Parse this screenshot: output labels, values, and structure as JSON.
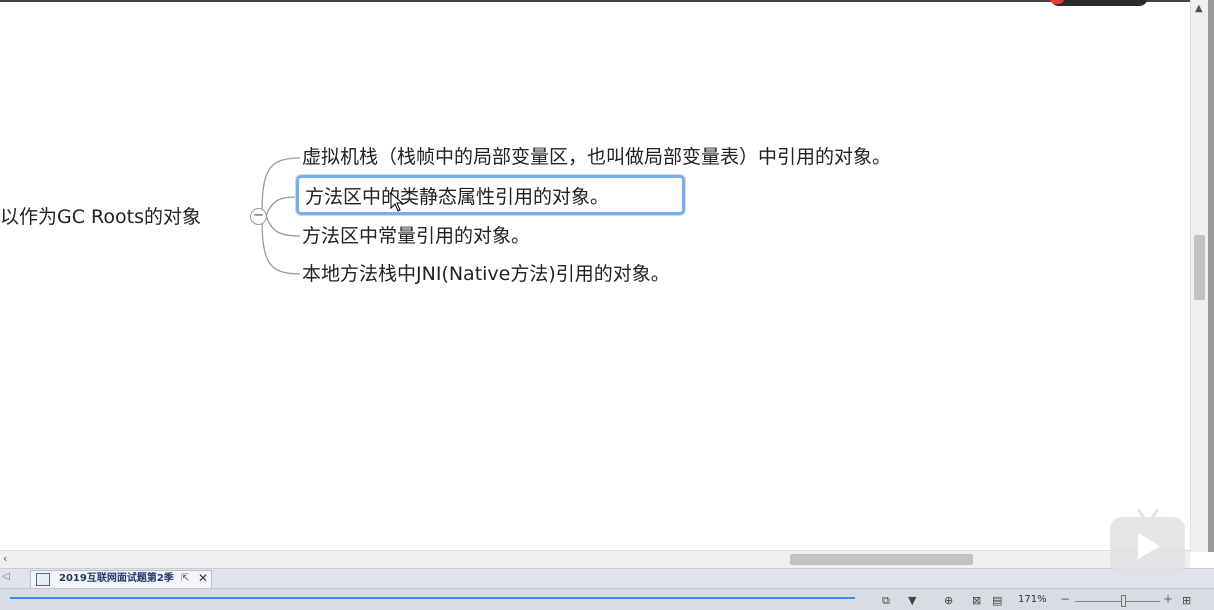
{
  "mindmap": {
    "root_topic": "以作为GC Roots的对象",
    "collapse_symbol": "−",
    "branches": [
      "虚拟机栈（栈帧中的局部变量区，也叫做局部变量表）中引用的对象。",
      "方法区中的类静态属性引用的对象。",
      "方法区中常量引用的对象。",
      "本地方法栈中JNI(Native方法)引用的对象。"
    ],
    "selected_branch_index": 1
  },
  "tab_bar": {
    "document_tab": "2019互联网面试题第2季",
    "pop_out_symbol": "⇱",
    "close_symbol": "✕"
  },
  "status_bar": {
    "zoom": "171%"
  },
  "icons": [
    "scroll-up-icon",
    "scroll-left-icon",
    "document-icon",
    "filter-icon",
    "add-topic-icon",
    "view-icon",
    "page-icon",
    "play-icon"
  ],
  "colors": {
    "selection_border": "#7aaee8",
    "progress_line": "#3b8fe0"
  }
}
